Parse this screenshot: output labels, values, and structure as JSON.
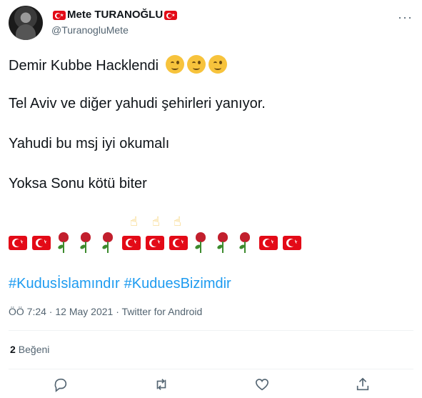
{
  "tweet": {
    "author": {
      "display_name": "Mete TURANOĞLU",
      "handle": "@TuranogluMete",
      "avatar_icon": "avatar-photo"
    },
    "more_icon": "more-dots-icon",
    "lines": [
      "Demir Kubbe Hacklendi",
      "Tel Aviv ve diğer yahudi şehirleri yanıyor.",
      "Yahudi bu msj iyi okumalı",
      "Yoksa Sonu kötü biter"
    ],
    "wink_emoji_count": 3,
    "emoji_row": [
      "turkish-flag-icon",
      "turkish-flag-icon",
      "rose-icon",
      "rose-icon",
      "rose-icon",
      "turkish-flag-icon",
      "turkish-flag-icon",
      "turkish-flag-icon",
      "rose-icon",
      "rose-icon",
      "rose-icon",
      "turkish-flag-icon",
      "turkish-flag-icon"
    ],
    "hashtags": [
      "#Kudusİslamındır",
      "#KuduesBizimdir"
    ],
    "meta": "ÖÖ 7:24 · 12 May 2021 · Twitter for Android",
    "likes": {
      "count": "2",
      "label": "Beğeni"
    },
    "actions": [
      "reply-icon",
      "retweet-icon",
      "like-icon",
      "share-icon"
    ]
  },
  "colors": {
    "text": "#0f1419",
    "secondary": "#536471",
    "link": "#1d9bf0",
    "flag_red": "#e30a17",
    "divider": "#eff3f4"
  }
}
